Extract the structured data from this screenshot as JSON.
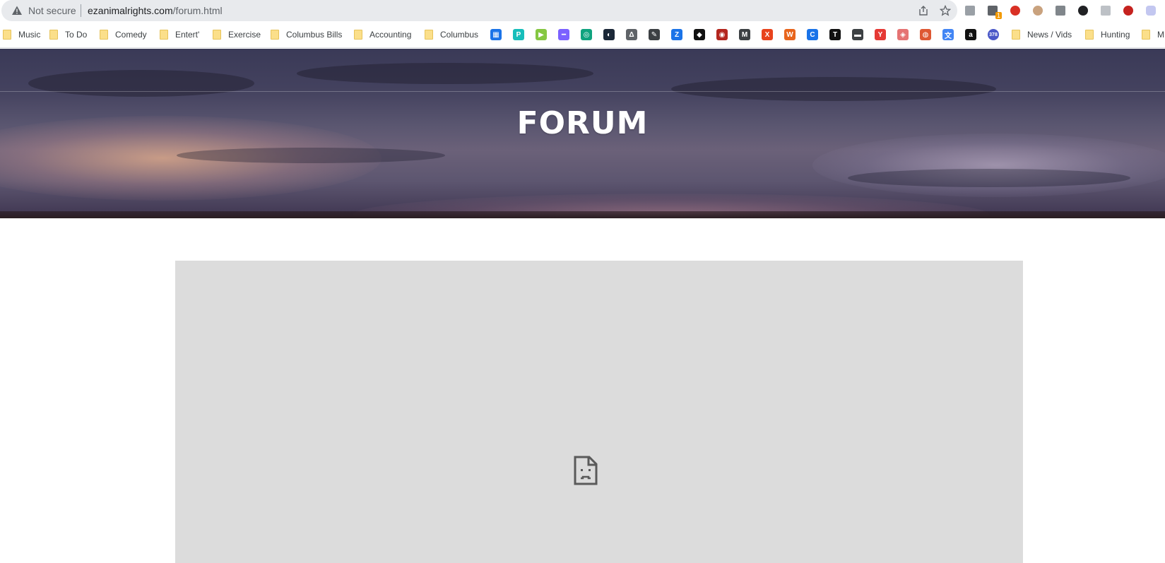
{
  "browser": {
    "security_label": "Not secure",
    "url_host": "ezanimalrights.com",
    "url_path": "/forum.html"
  },
  "bookmarks": {
    "folders": [
      "Music",
      "To Do",
      "Comedy",
      "Entert'",
      "Exercise",
      "Columbus Bills",
      "Accounting",
      "Columbus",
      "News / Vids",
      "Hunting",
      "M"
    ],
    "icons": [
      {
        "name": "grid-apps-icon",
        "color": "#1a73e8",
        "glyph": "▦"
      },
      {
        "name": "pcloud-icon",
        "color": "#17bebb",
        "glyph": "P"
      },
      {
        "name": "rumble-play-icon",
        "color": "#85c742",
        "glyph": "▶"
      },
      {
        "name": "rainbow-bar-icon",
        "color": "#7b61ff",
        "glyph": "━"
      },
      {
        "name": "chatgpt-icon",
        "color": "#10a37f",
        "glyph": "◎"
      },
      {
        "name": "steam-icon",
        "color": "#1b2838",
        "glyph": "◐"
      },
      {
        "name": "delta-icon",
        "color": "#5f6368",
        "glyph": "Δ"
      },
      {
        "name": "feather-icon",
        "color": "#3c4043",
        "glyph": "✎"
      },
      {
        "name": "zoom-z-icon",
        "color": "#1a73e8",
        "glyph": "Z"
      },
      {
        "name": "black-square-icon",
        "color": "#111111",
        "glyph": "◆"
      },
      {
        "name": "red-target-icon",
        "color": "#b3261e",
        "glyph": "◉"
      },
      {
        "name": "imdb-mdbg-icon",
        "color": "#3c4043",
        "glyph": "M"
      },
      {
        "name": "x-letter-icon",
        "color": "#e8431d",
        "glyph": "X"
      },
      {
        "name": "w-letter-icon",
        "color": "#e8651d",
        "glyph": "W"
      },
      {
        "name": "c-letter-icon",
        "color": "#1a73e8",
        "glyph": "C"
      },
      {
        "name": "tv-icon",
        "color": "#111111",
        "glyph": "T"
      },
      {
        "name": "couch-icon",
        "color": "#3c4043",
        "glyph": "▬"
      },
      {
        "name": "y-letter-icon",
        "color": "#e53935",
        "glyph": "Y"
      },
      {
        "name": "shield-red-icon",
        "color": "#e57373",
        "glyph": "◈"
      },
      {
        "name": "duckduckgo-icon",
        "color": "#de5833",
        "glyph": "◍"
      },
      {
        "name": "translate-icon",
        "color": "#4285f4",
        "glyph": "文"
      },
      {
        "name": "amazon-icon",
        "color": "#111111",
        "glyph": "a"
      },
      {
        "name": "badge-378-icon",
        "color": "#4a58c8",
        "glyph": "378"
      }
    ]
  },
  "extensions": [
    "tab-manager-icon",
    "extension-badge-icon",
    "adblock-icon",
    "owl-icon",
    "film-icon",
    "bold-letter-icon",
    "grey-letter-icon",
    "youtube-icon",
    "shield-icon"
  ],
  "extension_badge": "1",
  "hero": {
    "title": "FORUM"
  },
  "colors": {
    "frame_bg": "#dcdcdc",
    "omnibox_bg": "#e8eaed"
  }
}
